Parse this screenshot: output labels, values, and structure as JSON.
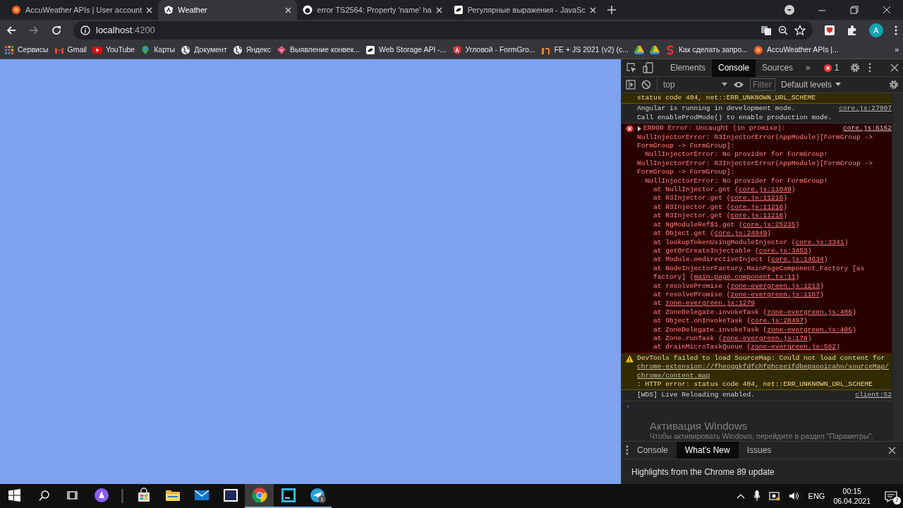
{
  "browser": {
    "tabs": [
      {
        "title": "AccuWeather APIs | User account",
        "selected": false
      },
      {
        "title": "Weather",
        "selected": true
      },
      {
        "title": "error TS2564: Property 'name' ha",
        "selected": false
      },
      {
        "title": "Регулярные выражения - JavaSc",
        "selected": false
      }
    ],
    "back": {
      "disabled": false
    },
    "forward": {
      "disabled": true
    },
    "address": {
      "host": "localhost",
      "port": ":4200"
    },
    "avatar": "A",
    "bookmarks": [
      {
        "label": "Сервисы"
      },
      {
        "label": "Gmail"
      },
      {
        "label": "YouTube"
      },
      {
        "label": "Карты"
      },
      {
        "label": "Документ"
      },
      {
        "label": "Яндекс"
      },
      {
        "label": "Выявление конвек..."
      },
      {
        "label": "Web Storage API -..."
      },
      {
        "label": "Угловой - FormGro..."
      },
      {
        "label": "FE + JS 2021 (v2) (c..."
      },
      {
        "label": "Как сделать запро..."
      },
      {
        "label": "AccuWeather APIs |..."
      }
    ],
    "more_bookmarks": "»"
  },
  "devtools": {
    "tabs": [
      {
        "label": "Elements",
        "selected": false
      },
      {
        "label": "Console",
        "selected": true
      },
      {
        "label": "Sources",
        "selected": false
      }
    ],
    "more_tabs": "»",
    "error_count": "1",
    "context": "top",
    "filter_placeholder": "Filter",
    "levels": "Default levels",
    "messages": [
      {
        "kind": "warning",
        "text": "status code 404, net::ERR_UNKNOWN_URL_SCHEME"
      },
      {
        "kind": "info",
        "text": "Angular is running in development mode.\nCall enableProdMode() to enable production mode.",
        "source": "core.js:27907"
      },
      {
        "kind": "error",
        "text": "ERROR Error: Uncaught (in promise):",
        "source": "core.js:6162",
        "expanded": false,
        "detail": [
          "NullInjectorError: R3InjectorError(AppModule)[FormGroup -> FormGroup -> FormGroup]:",
          "  NullInjectorError: No provider for FormGroup!",
          "NullInjectorError: R3InjectorError(AppModule)[FormGroup -> FormGroup -> FormGroup]:",
          "  NullInjectorError: No provider for FormGroup!"
        ],
        "stack": [
          {
            "pre": "at NullInjector.get (",
            "link": "core.js:11049",
            "post": ")"
          },
          {
            "pre": "at R3Injector.get (",
            "link": "core.js:11216",
            "post": ")"
          },
          {
            "pre": "at R3Injector.get (",
            "link": "core.js:11216",
            "post": ")"
          },
          {
            "pre": "at R3Injector.get (",
            "link": "core.js:11216",
            "post": ")"
          },
          {
            "pre": "at NgModuleRef$1.get (",
            "link": "core.js:25235",
            "post": ")"
          },
          {
            "pre": "at Object.get (",
            "link": "core.js:24949",
            "post": ")"
          },
          {
            "pre": "at lookupTokenUsingModuleInjector (",
            "link": "core.js:3341",
            "post": ")"
          },
          {
            "pre": "at getOrCreateInjectable (",
            "link": "core.js:3453",
            "post": ")"
          },
          {
            "pre": "at Module.ɵɵdirectiveInject (",
            "link": "core.js:14634",
            "post": ")"
          },
          {
            "pre": "at NodeInjectorFactory.MainPageComponent_Factory [as factory] (",
            "link": "main-page.component.ts:11",
            "post": ")"
          },
          {
            "pre": "at resolvePromise (",
            "link": "zone-evergreen.js:1213",
            "post": ")"
          },
          {
            "pre": "at resolvePromise (",
            "link": "zone-evergreen.js:1167",
            "post": ")"
          },
          {
            "pre": "at ",
            "link": "zone-evergreen.js:1279"
          },
          {
            "pre": "at ZoneDelegate.invokeTask (",
            "link": "zone-evergreen.js:406",
            "post": ")"
          },
          {
            "pre": "at Object.onInvokeTask (",
            "link": "core.js:28497",
            "post": ")"
          },
          {
            "pre": "at ZoneDelegate.invokeTask (",
            "link": "zone-evergreen.js:405",
            "post": ")"
          },
          {
            "pre": "at Zone.runTask (",
            "link": "zone-evergreen.js:178",
            "post": ")"
          },
          {
            "pre": "at drainMicroTaskQueue (",
            "link": "zone-evergreen.js:582",
            "post": ")"
          }
        ]
      },
      {
        "kind": "warning",
        "text": "DevTools failed to load SourceMap: Could not load content for ",
        "link": "chrome-extension://fheoggkfdfchfphceeifdbepaooicaho/sourceMap/chrome/content.map",
        "post": ": HTTP error: status code 404, net::ERR_UNKNOWN_URL_SCHEME"
      },
      {
        "kind": "info",
        "text": "[WDS] Live Reloading enabled.",
        "source": "client:52"
      }
    ],
    "prompt": "›",
    "drawer_tabs": [
      {
        "label": "Console",
        "selected": false
      },
      {
        "label": "What's New",
        "selected": true
      },
      {
        "label": "Issues",
        "selected": false
      }
    ],
    "drawer_text": "Highlights from the Chrome 89 update"
  },
  "activation": {
    "title": "Активация Windows",
    "text": "Чтобы активировать Windows, перейдите в раздел \"Параметры\"."
  },
  "taskbar": {
    "apps": [
      {
        "running": false,
        "selected": false
      },
      {
        "running": false,
        "selected": false
      },
      {
        "running": false,
        "selected": false
      },
      {
        "running": false,
        "selected": false
      },
      {
        "running": true,
        "selected": true
      },
      {
        "running": true,
        "selected": false
      },
      {
        "running": true,
        "selected": false,
        "badge": "1"
      }
    ],
    "language": "ENG",
    "time": "00:15",
    "date": "06.04.2021",
    "notifications": "2"
  }
}
